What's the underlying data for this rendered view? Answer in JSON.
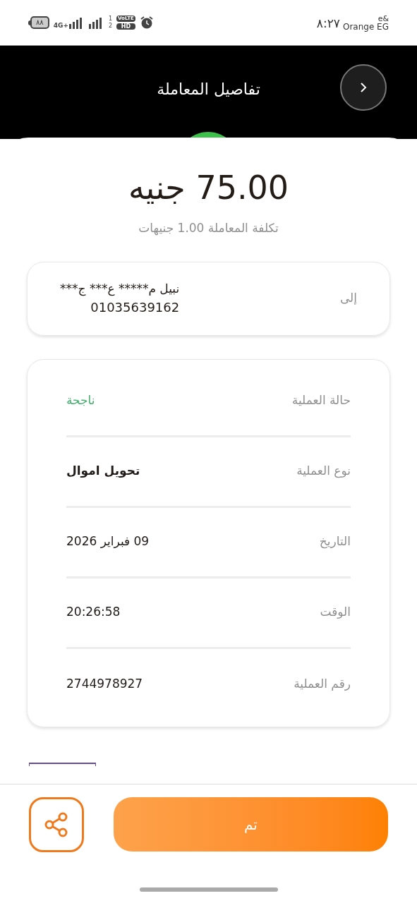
{
  "status_bar": {
    "carrier_top": "e&",
    "carrier": "Orange EG",
    "time": "٨:٢٧",
    "battery": "٨٨",
    "network": "4G+",
    "sim_1": "1",
    "sim_2": "2",
    "volte": "VoLTE",
    "hd": "HD"
  },
  "header": {
    "title": "تفاصيل المعاملة"
  },
  "amount": "75.00 جنيه",
  "fee": "تكلفة المعاملة 1.00 جنيهات",
  "recipient": {
    "label": "إلى",
    "name": "نبيل م***** ع*** ج***",
    "phone": "01035639162"
  },
  "details": [
    {
      "label": "حالة العملية",
      "value": "ناجحة",
      "kind": "success"
    },
    {
      "label": "نوع العملية",
      "value": "تحويل اموال",
      "kind": "bold"
    },
    {
      "label": "التاريخ",
      "value": "09 فبراير 2026",
      "kind": "plain"
    },
    {
      "label": "الوقت",
      "value": "20:26:58",
      "kind": "plain"
    },
    {
      "label": "رقم العملية",
      "value": "2744978927",
      "kind": "plain"
    }
  ],
  "done_button": "تم"
}
